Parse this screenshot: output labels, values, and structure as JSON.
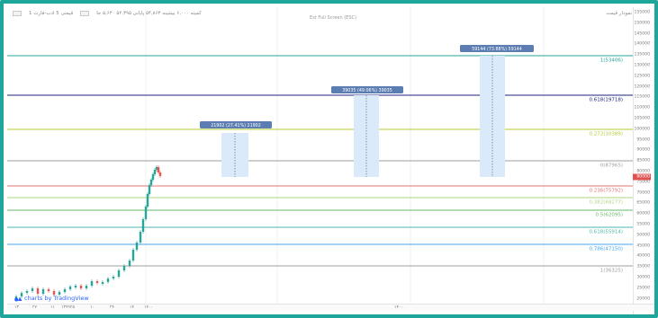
{
  "header": {
    "left_label": "قیمتی 5 ادب-فارت 1",
    "info_text": "کمینه ۶,۰۰۰  بیشینه ۵۴,۸۶۳  پایانی ۵۲,۳۹۵  ۵,۶۴۰ جا",
    "center_title": "Est Full Screen (ESC)",
    "right_label": "نمودار قیمت"
  },
  "fib_levels": [
    {
      "label": "1(53406)",
      "price": 53406,
      "color": "#26a69a"
    },
    {
      "label": "0.618(19718)",
      "price": 19718,
      "color": "#1a237e"
    },
    {
      "label": "0.272(10389)",
      "price": 10389,
      "color": "#b5c934"
    },
    {
      "label": "0(87965)",
      "price": 87965,
      "color": "#9e9e9e"
    },
    {
      "label": "0.236(75792)",
      "price": 75792,
      "color": "#e57373"
    },
    {
      "label": "0.382(68277)",
      "price": 68277,
      "color": "#aed581"
    },
    {
      "label": "0.5(62095)",
      "price": 62095,
      "color": "#66bb6a"
    },
    {
      "label": "0.618(55914)",
      "price": 55914,
      "color": "#4db6ac"
    },
    {
      "label": "0.786(47150)",
      "price": 47150,
      "color": "#42a5f5"
    },
    {
      "label": "1(36325)",
      "price": 36325,
      "color": "#9e9e9e"
    }
  ],
  "targets": [
    {
      "label": "21902 (27.41%) 21902"
    },
    {
      "label": "39035 (49.06%) 39035"
    },
    {
      "label": "59144 (73.88%) 59144"
    }
  ],
  "price_axis": [
    "155000",
    "150000",
    "145000",
    "140000",
    "135000",
    "130000",
    "125000",
    "120000",
    "115000",
    "110000",
    "105000",
    "100000",
    "95000",
    "90000",
    "85000",
    "80000",
    "75000",
    "70000",
    "65000",
    "60000",
    "55000",
    "50000",
    "45000",
    "40000",
    "35000",
    "30000",
    "25000",
    "20000"
  ],
  "current_price_mark": "80000",
  "time_axis": [
    "۱۳",
    "۲۷",
    "۱۱",
    "۲۵",
    "۱۰",
    "۲۴",
    "۱۴",
    "۱۴۰۰",
    "۱۳۹۹",
    "۱۴۰۰"
  ],
  "watermark": "charts by TradingView",
  "colors": {
    "frame": "#1fa69a",
    "target_box": "#dbeafb",
    "candle_up": "#26a69a",
    "candle_down": "#ef5350"
  }
}
